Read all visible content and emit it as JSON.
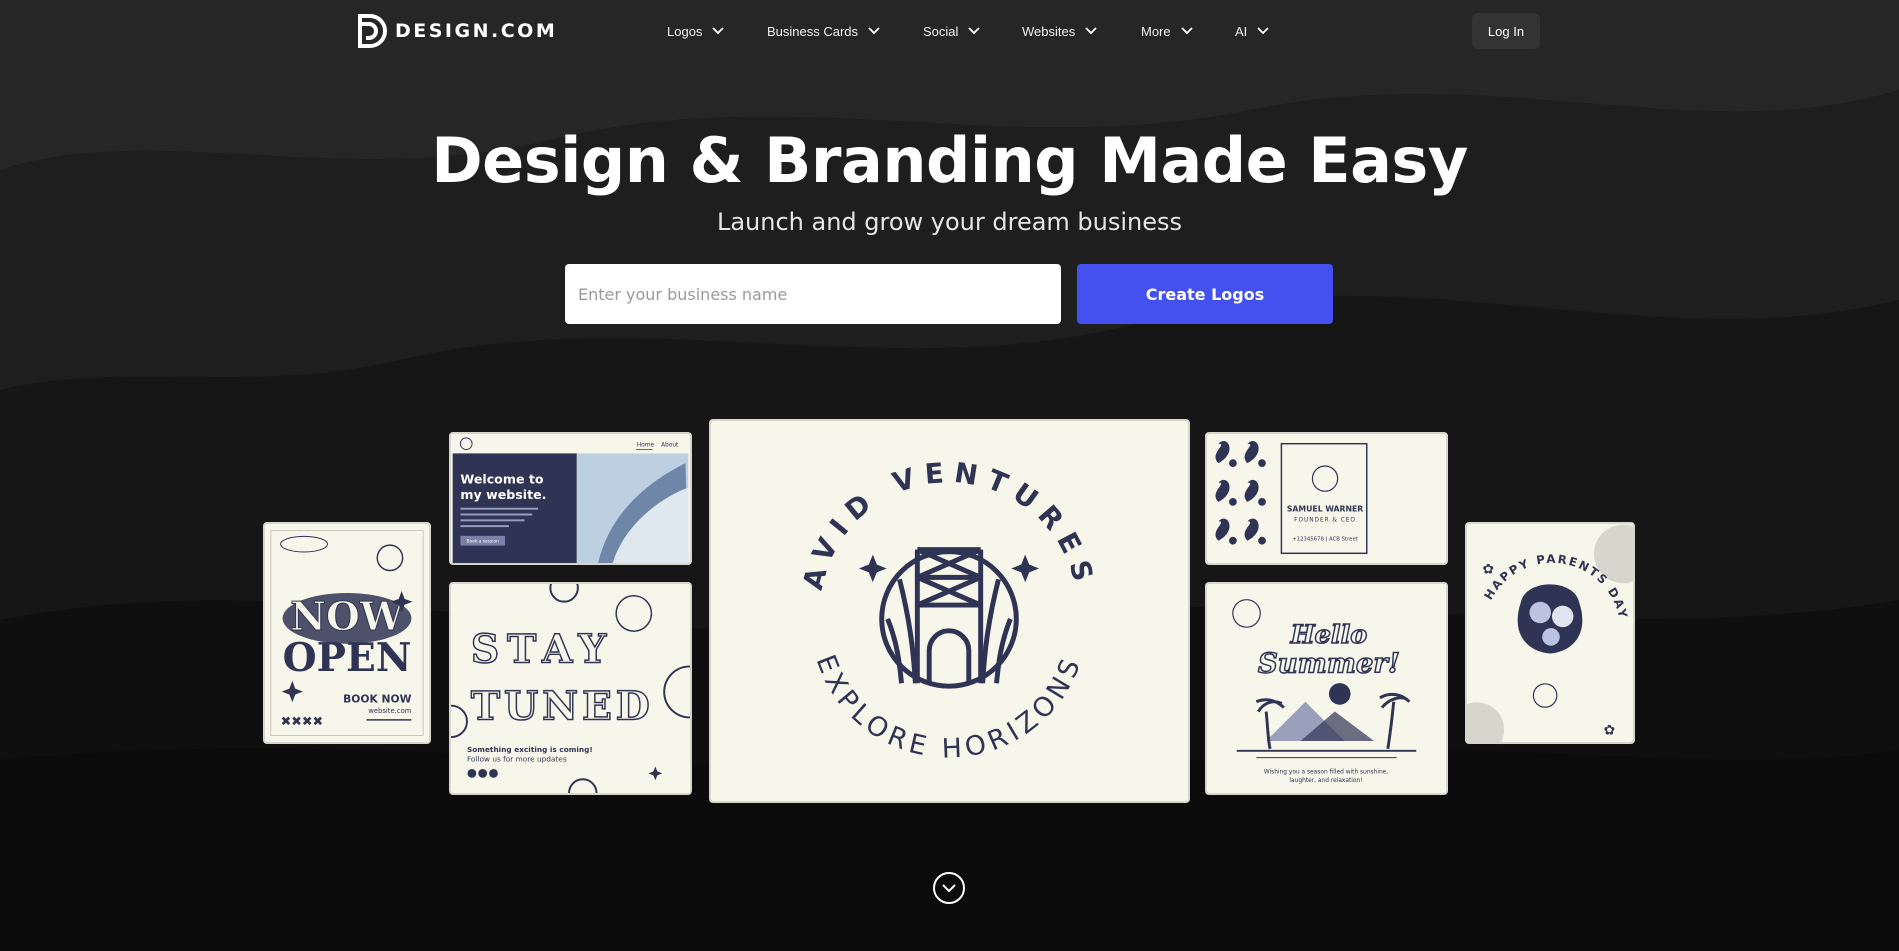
{
  "brand": {
    "name": "DESIGN.COM",
    "icon": "design-logo-icon"
  },
  "nav": {
    "items": [
      {
        "label": "Logos"
      },
      {
        "label": "Business Cards"
      },
      {
        "label": "Social"
      },
      {
        "label": "Websites"
      },
      {
        "label": "More"
      },
      {
        "label": "AI"
      }
    ],
    "login_label": "Log In"
  },
  "hero": {
    "title": "Design & Branding Made Easy",
    "subtitle": "Launch and grow your dream business",
    "search_placeholder": "Enter your business name",
    "cta_label": "Create Logos"
  },
  "showcase": {
    "main_logo": {
      "top_text": "AVID VENTURES",
      "bottom_text": "EXPLORE HORIZONS"
    },
    "now_open": {
      "line1": "NOW",
      "line2": "OPEN",
      "book": "BOOK NOW",
      "site": "website.com"
    },
    "website": {
      "nav1": "Home",
      "nav2": "About",
      "heading1": "Welcome to",
      "heading2": "my website.",
      "body": "Contact us today! Our friendly team is here to assist you every step of the way",
      "button": "Book a session"
    },
    "stay_tuned": {
      "line1": "STAY",
      "line2": "TUNED",
      "caption1": "Something exciting is coming!",
      "caption2": "Follow us for more updates"
    },
    "business_card": {
      "name": "SAMUEL WARNER",
      "title": "FOUNDER & CEO",
      "contact": "+12345678 | ACB Street"
    },
    "summer": {
      "line1": "Hello",
      "line2": "Summer!",
      "caption1": "Wishing you a season filled with sunshine,",
      "caption2": "laughter, and relaxation!"
    },
    "parents": {
      "text": "HAPPY PARENTS DAY"
    }
  },
  "colors": {
    "accent": "#4551ee",
    "navy": "#2f3454",
    "cream": "#f7f6ea",
    "background": "#151515"
  }
}
